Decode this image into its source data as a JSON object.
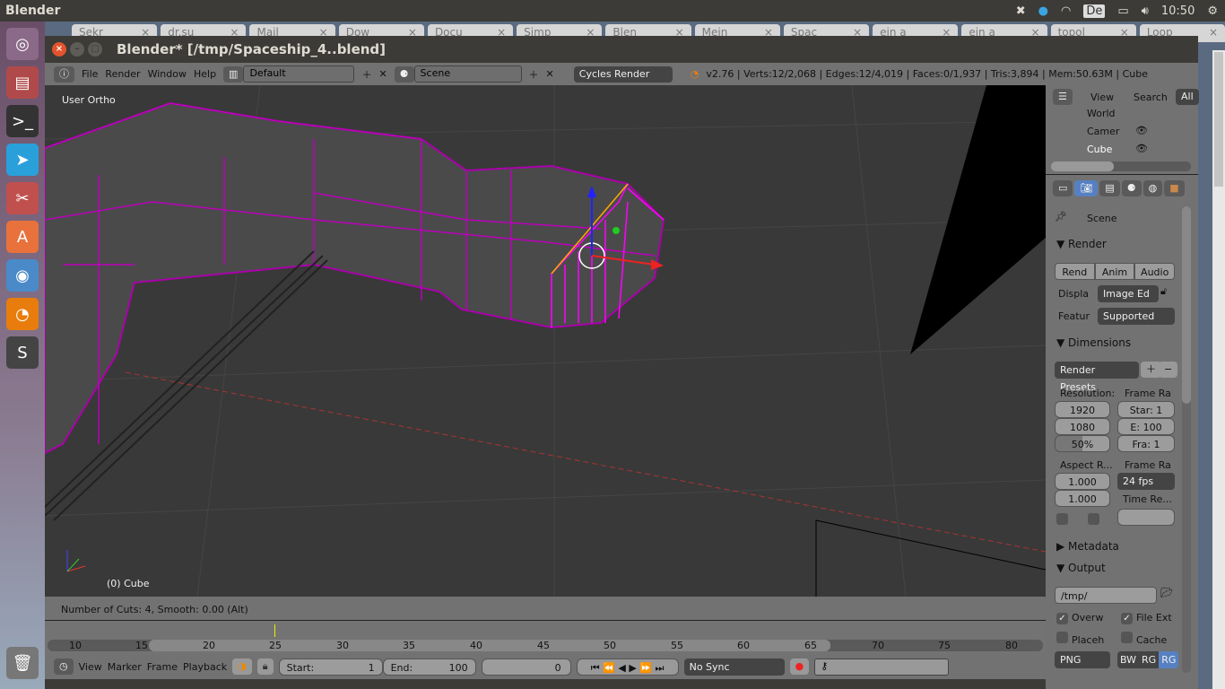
{
  "os": {
    "app_name": "Blender",
    "clock": "10:50",
    "keyboard": "De",
    "launcher": [
      "ubuntu-logo-icon",
      "files-icon",
      "terminal-icon",
      "telegram-icon",
      "settings-icon",
      "software-center-icon",
      "chromium-icon",
      "blender-icon",
      "sublime-icon",
      "trash-icon"
    ]
  },
  "browser_tabs": [
    "Sekr",
    "dr.su",
    "Mail",
    "Dow",
    "Docu",
    "Simp",
    "Blen",
    "Mein",
    "Spac",
    "ein a",
    "ein a",
    "topol",
    "Loop"
  ],
  "window": {
    "title": "Blender* [/tmp/Spaceship_4..blend]"
  },
  "info": {
    "menu": [
      "File",
      "Render",
      "Window",
      "Help"
    ],
    "layout": "Default",
    "scene": "Scene",
    "engine": "Cycles Render",
    "stats": "v2.76 | Verts:12/2,068 | Edges:12/4,019 | Faces:0/1,937 | Tris:3,894 | Mem:50.63M | Cube"
  },
  "viewport": {
    "view_label": "User Ortho",
    "object_label": "(0) Cube"
  },
  "operator": {
    "text": "Number of Cuts: 4, Smooth: 0.00 (Alt)"
  },
  "timeline": {
    "ticks": [
      "10",
      "15",
      "20",
      "25",
      "30",
      "35",
      "40",
      "45",
      "50",
      "55",
      "60",
      "65",
      "70",
      "75",
      "80"
    ],
    "current_frame": 25,
    "menu": [
      "View",
      "Marker",
      "Frame",
      "Playback"
    ],
    "start_label": "Start:",
    "start": "1",
    "end_label": "End:",
    "end": "100",
    "frame": "0",
    "sync": "No Sync"
  },
  "outliner": {
    "menu": [
      "View",
      "Search",
      "All"
    ],
    "items": [
      "World",
      "Camer",
      "Cube"
    ]
  },
  "properties": {
    "context": "Scene",
    "render": {
      "title": "Render",
      "buttons": [
        "Rend",
        "Anim",
        "Audio"
      ],
      "display_label": "Displa",
      "display": "Image Ed",
      "feature_label": "Featur",
      "feature": "Supported"
    },
    "dimensions": {
      "title": "Dimensions",
      "presets": "Render Presets",
      "resolution_label": "Resolution:",
      "res_x": "1920",
      "res_y": "1080",
      "res_pct": "50%",
      "res_pct_value": 50,
      "frame_range_label": "Frame Ra",
      "start": "Star: 1",
      "end": "E: 100",
      "step": "Fra:  1",
      "aspect_label": "Aspect R...",
      "aspect_x": "1.000",
      "aspect_y": "1.000",
      "frame_rate_label": "Frame Ra",
      "fps": "24 fps",
      "time_remap_label": "Time Re..."
    },
    "metadata": {
      "title": "Metadata"
    },
    "output": {
      "title": "Output",
      "path": "/tmp/",
      "overwrite": "Overw",
      "file_ext": "File Ext",
      "placeholders": "Placeh",
      "cache": "Cache",
      "format": "PNG",
      "color_modes": [
        "BW",
        "RG",
        "RG"
      ]
    }
  }
}
